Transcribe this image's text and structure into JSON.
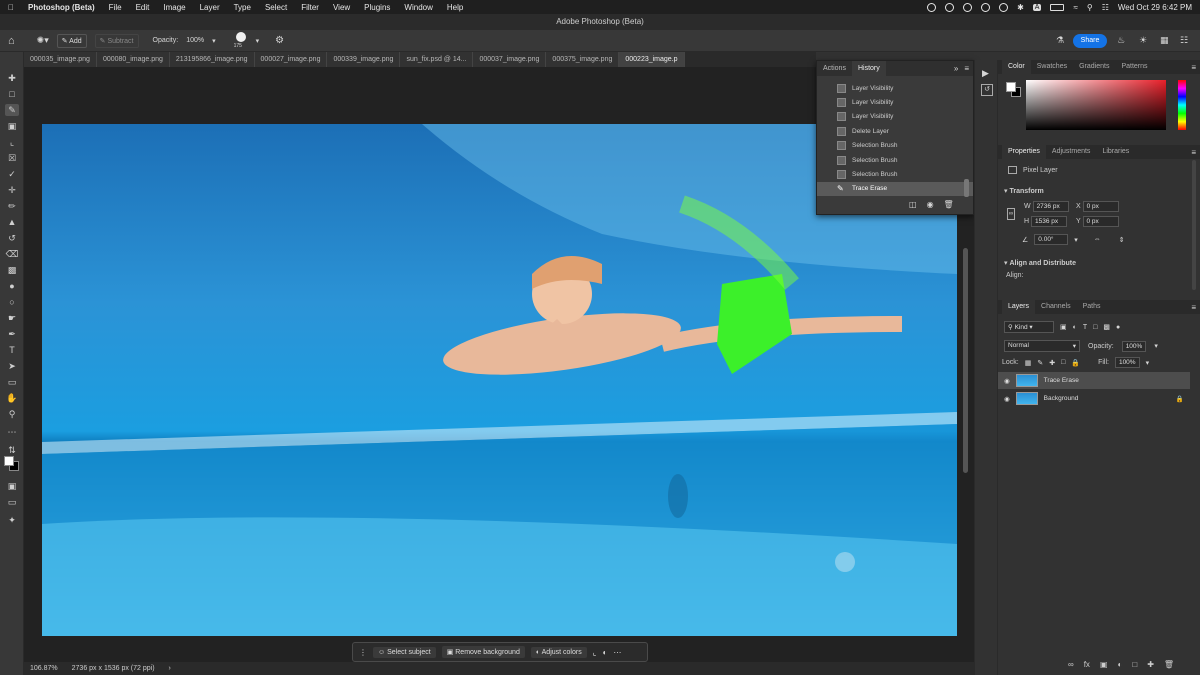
{
  "menubar": {
    "app": "Photoshop (Beta)",
    "items": [
      "File",
      "Edit",
      "Image",
      "Layer",
      "Type",
      "Select",
      "Filter",
      "View",
      "Plugins",
      "Window",
      "Help"
    ],
    "datetime": "Wed Oct 29  6:42 PM",
    "letter_a": "A"
  },
  "window_title": "Adobe Photoshop (Beta)",
  "options": {
    "add": "Add",
    "subtract": "Subtract",
    "opacity_label": "Opacity:",
    "opacity_value": "100%",
    "brush_size": "175",
    "share": "Share"
  },
  "tabs": [
    "000035_image.png",
    "000080_image.png",
    "213195866_image.png",
    "000027_image.png",
    "000339_image.png",
    "sun_fix.psd @ 14...",
    "000037_image.png",
    "000375_image.png",
    "000223_image.p"
  ],
  "history_panel": {
    "tabs": [
      "Actions",
      "History"
    ],
    "items": [
      "Layer Visibility",
      "Layer Visibility",
      "Layer Visibility",
      "Delete Layer",
      "Selection Brush",
      "Selection Brush",
      "Selection Brush",
      "Trace Erase"
    ],
    "active_index": 7
  },
  "color_panel": {
    "tabs": [
      "Color",
      "Swatches",
      "Gradients",
      "Patterns"
    ]
  },
  "properties_panel": {
    "tabs": [
      "Properties",
      "Adjustments",
      "Libraries"
    ],
    "type": "Pixel Layer",
    "transform_label": "Transform",
    "w_label": "W",
    "w_value": "2736 px",
    "h_label": "H",
    "h_value": "1536 px",
    "x_label": "X",
    "x_value": "0 px",
    "y_label": "Y",
    "y_value": "0 px",
    "angle": "0.00°",
    "align_label": "Align and Distribute",
    "align_sub": "Align:"
  },
  "layers_panel": {
    "tabs": [
      "Layers",
      "Channels",
      "Paths"
    ],
    "kind": "Kind",
    "blend": "Normal",
    "opacity_label": "Opacity:",
    "opacity_value": "100%",
    "lock_label": "Lock:",
    "fill_label": "Fill:",
    "fill_value": "100%",
    "layers": [
      "Trace Erase",
      "Background"
    ]
  },
  "context_bar": {
    "select_subject": "Select subject",
    "remove_background": "Remove background",
    "adjust_colors": "Adjust colors"
  },
  "status": {
    "zoom": "106.87%",
    "doc_size": "2736 px x 1536 px (72 ppi)"
  },
  "colors": {
    "accent": "#1473e6",
    "panel": "#323232"
  }
}
